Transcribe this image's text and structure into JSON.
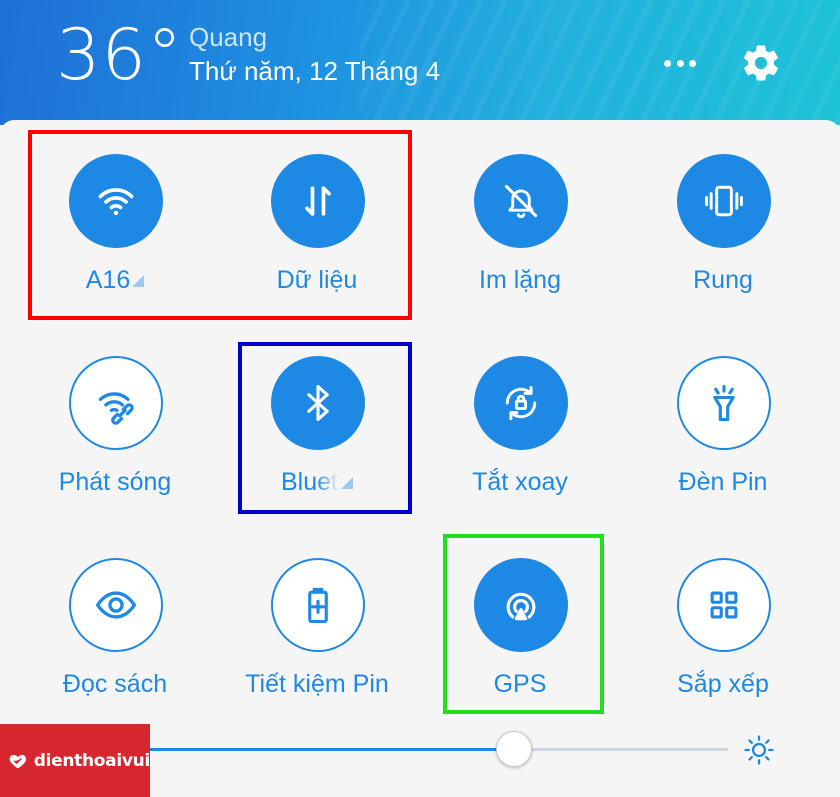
{
  "header": {
    "temperature": "36°",
    "location": "Quang",
    "date": "Thứ năm, 12 Tháng 4"
  },
  "icons": {
    "more": "more-dots-icon",
    "settings": "gear-icon",
    "brightness": "sun-icon"
  },
  "tiles": [
    {
      "label": "A16",
      "icon": "wifi-icon",
      "state": "on",
      "has_more": true
    },
    {
      "label": "Dữ liệu",
      "icon": "mobile-data-icon",
      "state": "on"
    },
    {
      "label": "Im lặng",
      "icon": "bell-off-icon",
      "state": "on"
    },
    {
      "label": "Rung",
      "icon": "vibrate-icon",
      "state": "on"
    },
    {
      "label": "Phát sóng",
      "icon": "hotspot-icon",
      "state": "off"
    },
    {
      "label": "Blueto",
      "icon": "bluetooth-icon",
      "state": "on",
      "has_more": true
    },
    {
      "label": "Tắt xoay",
      "icon": "rotation-lock-icon",
      "state": "on"
    },
    {
      "label": "Đèn Pin",
      "icon": "flashlight-icon",
      "state": "off"
    },
    {
      "label": "Đọc sách",
      "icon": "eye-icon",
      "state": "off"
    },
    {
      "label": "Tiết kiệm Pin",
      "icon": "battery-saver-icon",
      "state": "off"
    },
    {
      "label": "GPS",
      "icon": "location-icon",
      "state": "on"
    },
    {
      "label": "Sắp xếp",
      "icon": "grid-icon",
      "state": "off"
    }
  ],
  "highlights": [
    {
      "name": "wifi-data-group",
      "color": "#ff0000"
    },
    {
      "name": "bluetooth",
      "color": "#0000cc"
    },
    {
      "name": "gps",
      "color": "#22dd22"
    }
  ],
  "brightness": {
    "level": 0.66
  },
  "watermark": {
    "text": "dienthoaivui"
  },
  "colors": {
    "accent": "#1e88e5",
    "watermark_bg": "#d6262e"
  }
}
